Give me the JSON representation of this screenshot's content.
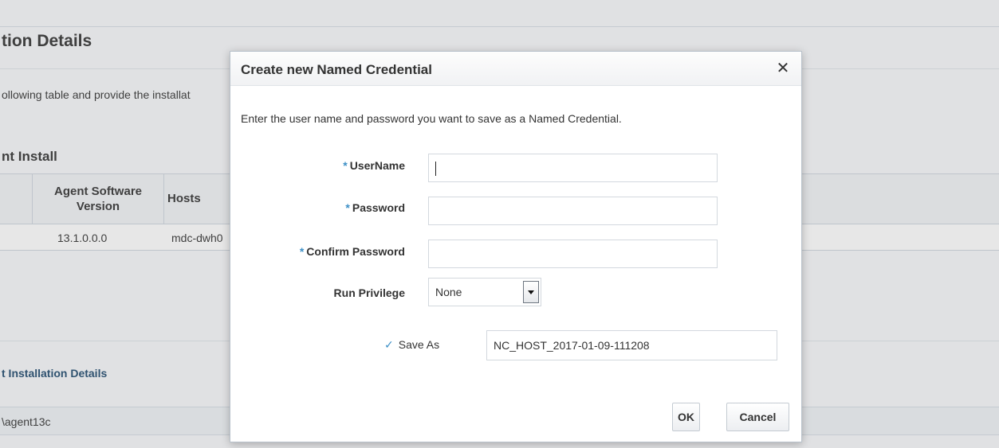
{
  "background": {
    "title": "tion Details",
    "instruction": "ollowing table and provide the installat",
    "section_title": "nt Install",
    "table": {
      "headers": [
        "Agent Software Version",
        "Hosts"
      ],
      "row": [
        "13.1.0.0.0",
        "mdc-dwh0"
      ]
    },
    "install_details_title": "t Installation Details",
    "install_path": "\\agent13c"
  },
  "dialog": {
    "title": "Create new Named Credential",
    "close_glyph": "✕",
    "instruction": "Enter the user name and password you want to save as a Named Credential.",
    "required_marker": "*",
    "fields": {
      "username": {
        "label": "UserName",
        "value": ""
      },
      "password": {
        "label": "Password",
        "value": ""
      },
      "confirm_password": {
        "label": "Confirm Password",
        "value": ""
      },
      "run_privilege": {
        "label": "Run Privilege",
        "selected": "None"
      },
      "save_as": {
        "label": "Save As",
        "checked": true,
        "value": "NC_HOST_2017-01-09-111208"
      }
    },
    "buttons": {
      "ok": "OK",
      "cancel": "Cancel"
    }
  },
  "icons": {
    "check": "✓",
    "close": "✕",
    "dropdown": "chevron-down-icon"
  },
  "colors": {
    "required_accent": "#3c8fc6",
    "link_title": "#1f4a6e"
  }
}
